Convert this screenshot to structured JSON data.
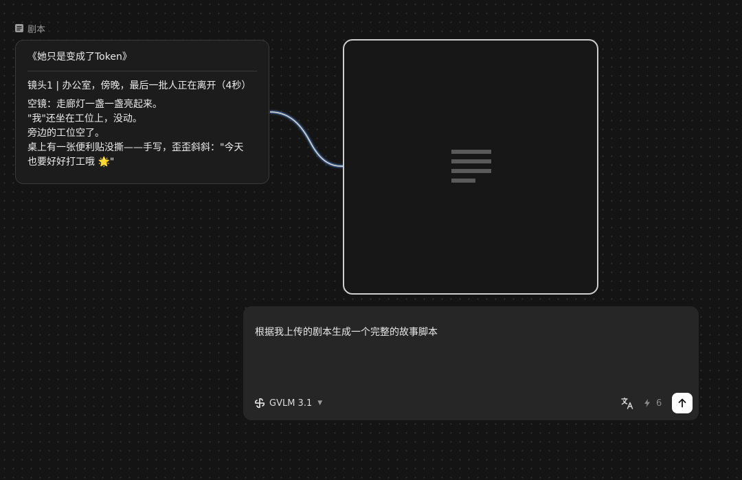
{
  "node": {
    "label": "剧本",
    "label_icon": "document-icon"
  },
  "script": {
    "title": "《她只是变成了Token》",
    "shot_heading": "镜头1 | 办公室，傍晚，最后一批人正在离开（4秒）",
    "lines": [
      "空镜：走廊灯一盏一盏亮起来。",
      "\"我\"还坐在工位上，没动。",
      "旁边的工位空了。",
      "桌上有一张便利贴没撕——手写，歪歪斜斜：\"今天",
      "也要好好打工哦 🌟\""
    ]
  },
  "output_node": {
    "icon": "text-lines-icon"
  },
  "prompt": {
    "text": "根据我上传的剧本生成一个完整的故事脚本",
    "model": "GVLM 3.1",
    "model_icon": "model-logo-icon",
    "credits": "6",
    "translate_icon": "translate-icon",
    "send_icon": "arrow-up-icon"
  },
  "colors": {
    "background": "#141414",
    "card": "#1c1c1c",
    "panel": "#262626",
    "connector_glow": "#5b8fd9",
    "send_button": "#ffffff"
  }
}
